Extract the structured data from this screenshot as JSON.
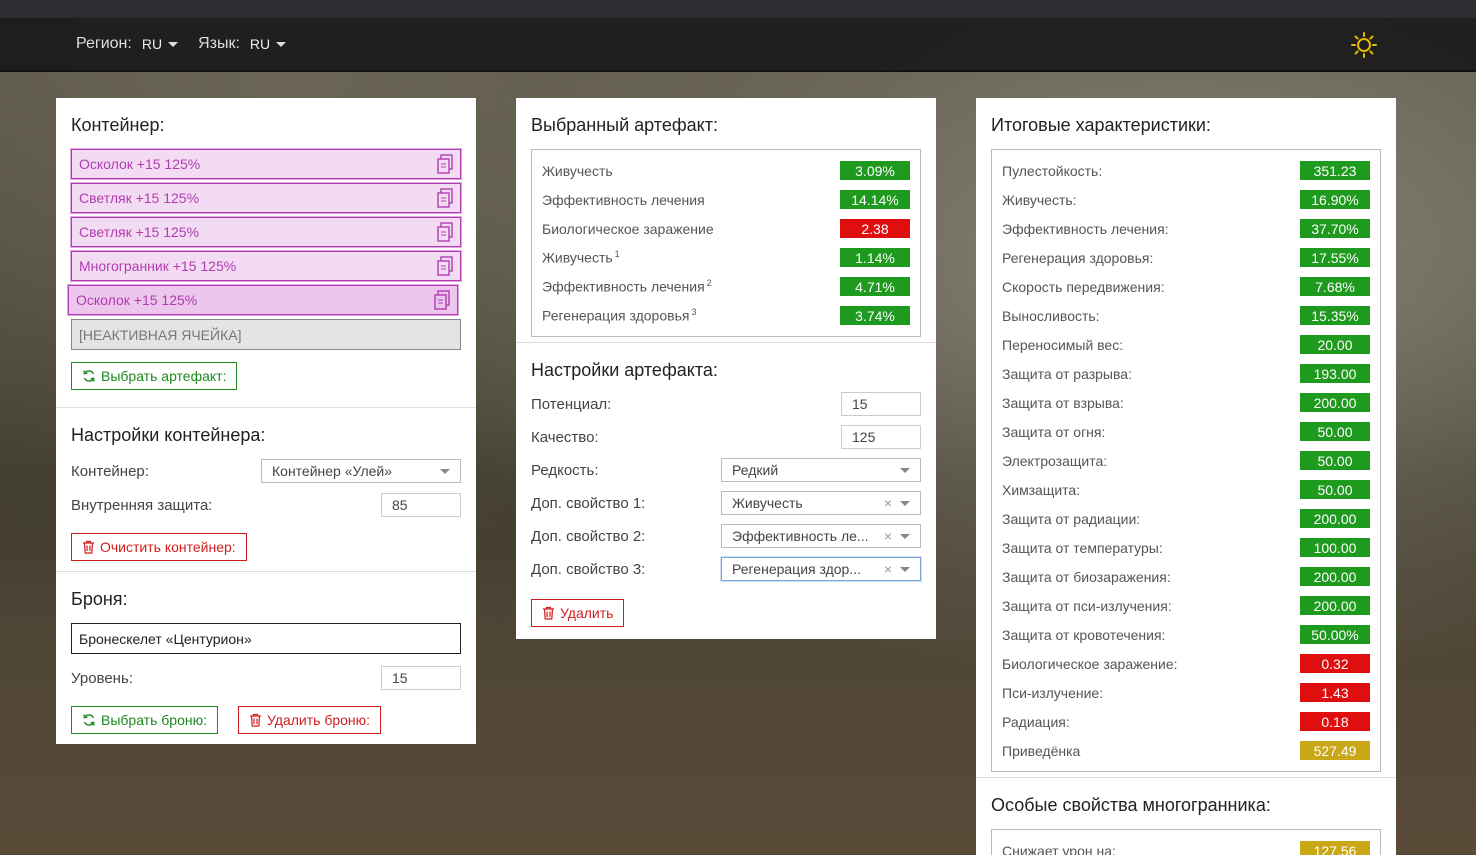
{
  "nav": {
    "region_label": "Регион:",
    "region_value": "RU",
    "language_label": "Язык:",
    "language_value": "RU"
  },
  "container": {
    "title": "Контейнер:",
    "slots": [
      {
        "label": "Осколок +15 125%"
      },
      {
        "label": "Светляк +15 125%"
      },
      {
        "label": "Светляк +15 125%"
      },
      {
        "label": "Многогранник +15 125%"
      },
      {
        "label": "Осколок +15 125%"
      }
    ],
    "inactive_slot": "[НЕАКТИВНАЯ ЯЧЕЙКА]",
    "choose_artifact_button": "Выбрать артефакт:"
  },
  "container_settings": {
    "title": "Настройки контейнера:",
    "container_label": "Контейнер:",
    "container_value": "Контейнер «Улей»",
    "internal_protection_label": "Внутренняя защита:",
    "internal_protection_value": "85",
    "clear_button": "Очистить контейнер:"
  },
  "armor": {
    "title": "Броня:",
    "armor_value": "Бронескелет «Центурион»",
    "level_label": "Уровень:",
    "level_value": "15",
    "choose_button": "Выбрать броню:",
    "delete_button": "Удалить броню:"
  },
  "selected_artifact": {
    "title": "Выбранный артефакт:",
    "stats": [
      {
        "label": "Живучесть",
        "sup": "",
        "value": "3.09%",
        "color": "green"
      },
      {
        "label": "Эффективность лечения",
        "sup": "",
        "value": "14.14%",
        "color": "green"
      },
      {
        "label": "Биологическое заражение",
        "sup": "",
        "value": "2.38",
        "color": "red"
      },
      {
        "label": "Живучесть",
        "sup": "1",
        "value": "1.14%",
        "color": "green"
      },
      {
        "label": "Эффективность лечения",
        "sup": "2",
        "value": "4.71%",
        "color": "green"
      },
      {
        "label": "Регенерация здоровья",
        "sup": "3",
        "value": "3.74%",
        "color": "green"
      }
    ]
  },
  "artifact_settings": {
    "title": "Настройки артефакта:",
    "potential_label": "Потенциал:",
    "potential_value": "15",
    "quality_label": "Качество:",
    "quality_value": "125",
    "rarity_label": "Редкость:",
    "rarity_value": "Редкий",
    "prop1_label": "Доп. свойство 1:",
    "prop1_value": "Живучесть",
    "prop2_label": "Доп. свойство 2:",
    "prop2_value": "Эффективность ле...",
    "prop3_label": "Доп. свойство 3:",
    "prop3_value": "Регенерация здор...",
    "delete_button": "Удалить"
  },
  "totals": {
    "title": "Итоговые характеристики:",
    "stats": [
      {
        "label": "Пулестойкость:",
        "value": "351.23",
        "color": "green"
      },
      {
        "label": "Живучесть:",
        "value": "16.90%",
        "color": "green"
      },
      {
        "label": "Эффективность лечения:",
        "value": "37.70%",
        "color": "green"
      },
      {
        "label": "Регенерация здоровья:",
        "value": "17.55%",
        "color": "green"
      },
      {
        "label": "Скорость передвижения:",
        "value": "7.68%",
        "color": "green"
      },
      {
        "label": "Выносливость:",
        "value": "15.35%",
        "color": "green"
      },
      {
        "label": "Переносимый вес:",
        "value": "20.00",
        "color": "green"
      },
      {
        "label": "Защита от разрыва:",
        "value": "193.00",
        "color": "green"
      },
      {
        "label": "Защита от взрыва:",
        "value": "200.00",
        "color": "green"
      },
      {
        "label": "Защита от огня:",
        "value": "50.00",
        "color": "green"
      },
      {
        "label": "Электрозащита:",
        "value": "50.00",
        "color": "green"
      },
      {
        "label": "Химзащита:",
        "value": "50.00",
        "color": "green"
      },
      {
        "label": "Защита от радиации:",
        "value": "200.00",
        "color": "green"
      },
      {
        "label": "Защита от температуры:",
        "value": "100.00",
        "color": "green"
      },
      {
        "label": "Защита от биозаражения:",
        "value": "200.00",
        "color": "green"
      },
      {
        "label": "Защита от пси-излучения:",
        "value": "200.00",
        "color": "green"
      },
      {
        "label": "Защита от кровотечения:",
        "value": "50.00%",
        "color": "green"
      },
      {
        "label": "Биологическое заражение:",
        "value": "0.32",
        "color": "red"
      },
      {
        "label": "Пси-излучение:",
        "value": "1.43",
        "color": "red"
      },
      {
        "label": "Радиация:",
        "value": "0.18",
        "color": "red"
      },
      {
        "label": "Приведёнка",
        "value": "527.49",
        "color": "gold"
      }
    ]
  },
  "special": {
    "title": "Особые свойства многогранника:",
    "stats": [
      {
        "label": "Снижает урон на:",
        "value": "127.56",
        "color": "gold"
      }
    ]
  },
  "colors": {
    "green": "#1e9a1e",
    "red": "#e00f0f",
    "gold": "#c9a716",
    "slot_purple": "#b13cb1"
  }
}
